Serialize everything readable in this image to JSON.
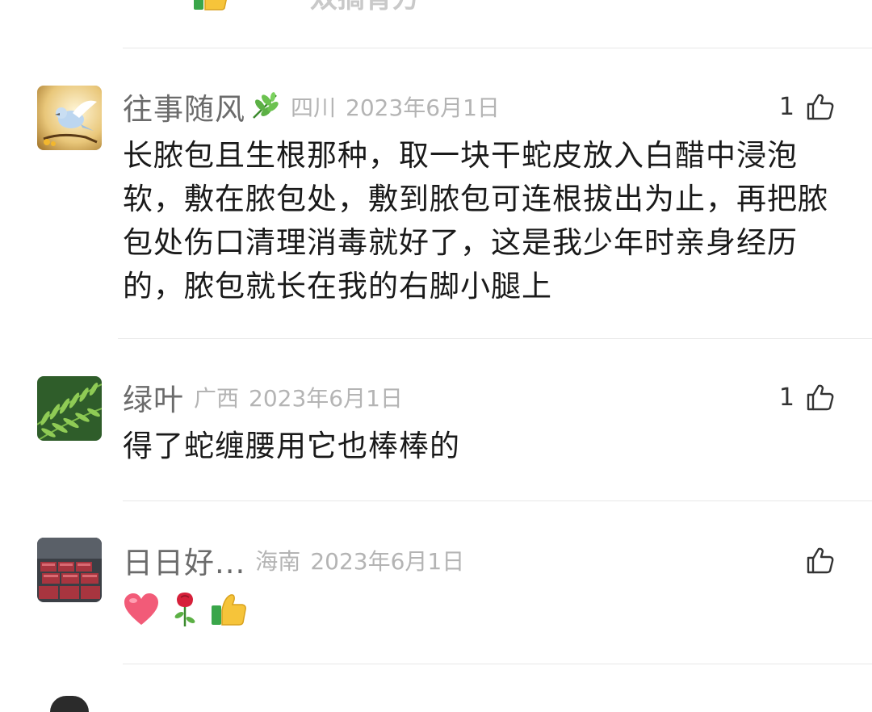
{
  "top_comment": {
    "text": "双搞育方",
    "emoji": "thumbs-up-emoji"
  },
  "comments": [
    {
      "author": "往事随风",
      "author_badge": "leaf-emoji",
      "region": "四川",
      "date": "2023年6月1日",
      "likes": "1",
      "text": "长脓包且生根那种，取一块干蛇皮放入白醋中浸泡软，敷在脓包处，敷到脓包可连根拔出为止，再把脓包处伤口清理消毒就好了，这是我少年时亲身经历的，脓包就长在我的右脚小腿上",
      "avatar": "dove-avatar"
    },
    {
      "author": "绿叶",
      "region": "广西",
      "date": "2023年6月1日",
      "likes": "1",
      "text": "得了蛇缠腰用它也棒棒的",
      "avatar": "fern-avatar"
    },
    {
      "author": "日日好...",
      "region": "海南",
      "date": "2023年6月1日",
      "likes": "",
      "emojis": [
        "heart-emoji",
        "rose-emoji",
        "thumbs-up-emoji"
      ],
      "avatar": "stacked-boxes-avatar"
    }
  ],
  "colors": {
    "name": "#6b6b6b",
    "meta": "#b4b4b4",
    "body": "#1a1a1a",
    "divider": "#e8e8e8"
  }
}
